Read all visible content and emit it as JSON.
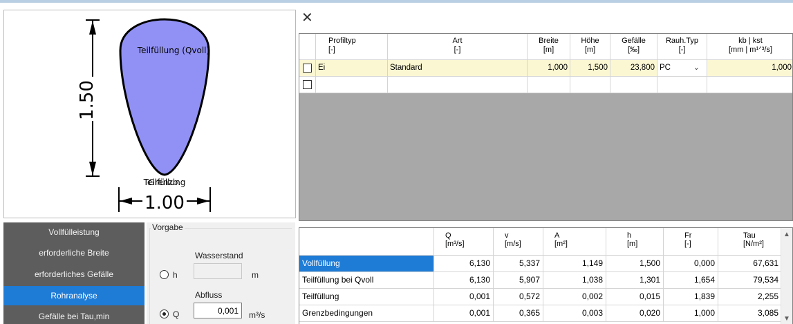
{
  "drawing": {
    "height_label": "1.50",
    "width_label": "1.00",
    "caption_top": "Teilfüllung (Qvoll)",
    "caption_bottom_a": "Teilfüllung",
    "caption_bottom_b": "Grenzb.",
    "fill_color": "#9191f5"
  },
  "nav": {
    "items": [
      {
        "label": "Vollfülleistung",
        "active": false
      },
      {
        "label": "erforderliche Breite",
        "active": false
      },
      {
        "label": "erforderliches Gefälle",
        "active": false
      },
      {
        "label": "Rohranalyse",
        "active": true
      },
      {
        "label": "Gefälle bei Tau,min",
        "active": false
      }
    ],
    "accent": "#1e7bd6"
  },
  "vorgabe": {
    "legend": "Vorgabe",
    "wasserstand_label": "Wasserstand",
    "h_label": "h",
    "h_value": "",
    "h_unit": "m",
    "abfluss_label": "Abfluss",
    "q_label": "Q",
    "q_value": "0,001",
    "q_unit": "m³/s",
    "selected": "Q"
  },
  "toolbar": {
    "close_glyph": "✕"
  },
  "profile_grid": {
    "columns": [
      {
        "name": "Profiltyp",
        "unit": "[-]"
      },
      {
        "name": "Art",
        "unit": "[-]"
      },
      {
        "name": "Breite",
        "unit": "[m]"
      },
      {
        "name": "Höhe",
        "unit": "[m]"
      },
      {
        "name": "Gefälle",
        "unit": "[‰]"
      },
      {
        "name": "Rauh.Typ",
        "unit": "[-]"
      },
      {
        "name": "kb | kst",
        "unit": "[mm | m¹ᐟ³/s]"
      }
    ],
    "rows": [
      {
        "profiltyp": "Ei",
        "art": "Standard",
        "breite": "1,000",
        "hoehe": "1,500",
        "gefaelle": "23,800",
        "rauh": "PC",
        "kb": "1,000"
      }
    ]
  },
  "results": {
    "columns": [
      {
        "name": "Q",
        "unit": "[m³/s]"
      },
      {
        "name": "v",
        "unit": "[m/s]"
      },
      {
        "name": "A",
        "unit": "[m²]"
      },
      {
        "name": "h",
        "unit": "[m]"
      },
      {
        "name": "Fr",
        "unit": "[-]"
      },
      {
        "name": "Tau",
        "unit": "[N/m²]"
      }
    ],
    "rows": [
      {
        "label": "Vollfüllung",
        "values": [
          "6,130",
          "5,337",
          "1,149",
          "1,500",
          "0,000",
          "67,631"
        ]
      },
      {
        "label": "Teilfüllung bei Qvoll",
        "values": [
          "6,130",
          "5,907",
          "1,038",
          "1,301",
          "1,654",
          "79,534"
        ]
      },
      {
        "label": "Teilfüllung",
        "values": [
          "0,001",
          "0,572",
          "0,002",
          "0,015",
          "1,839",
          "2,255"
        ]
      },
      {
        "label": "Grenzbedingungen",
        "values": [
          "0,001",
          "0,365",
          "0,003",
          "0,020",
          "1,000",
          "3,085"
        ]
      }
    ]
  }
}
